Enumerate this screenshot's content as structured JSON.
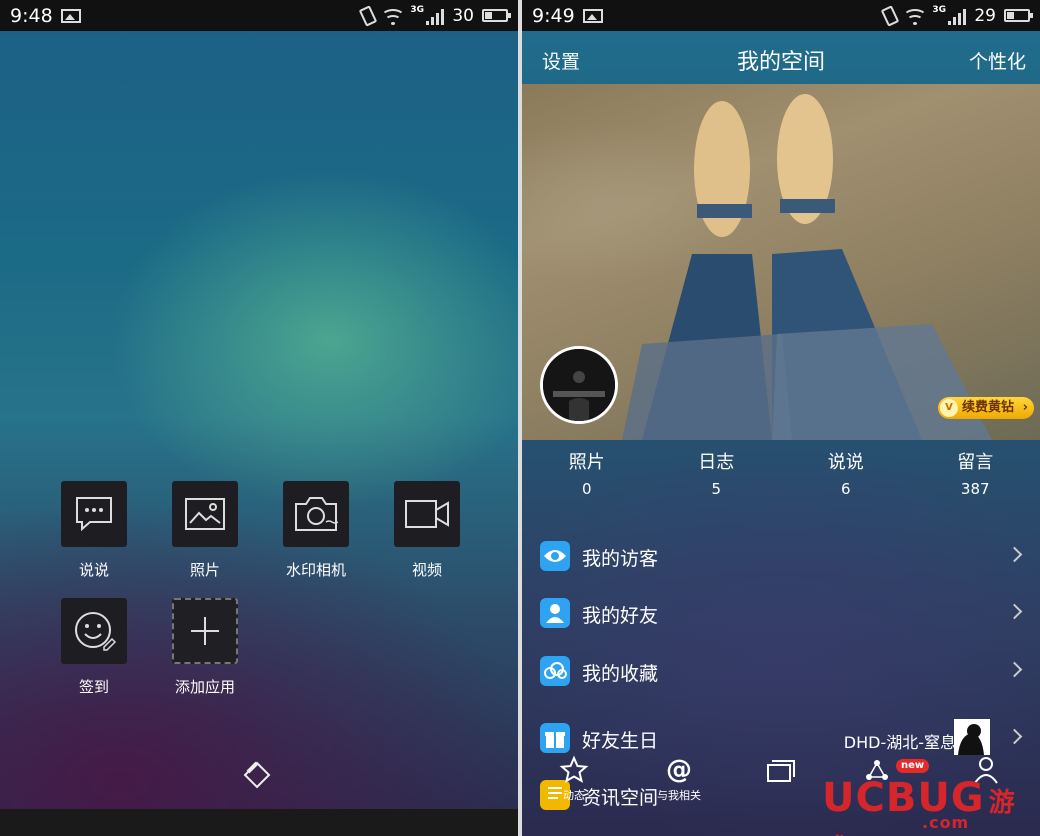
{
  "left": {
    "status": {
      "time": "9:48",
      "battery": "30",
      "network": "3G"
    },
    "tiles": [
      {
        "label": "说说",
        "icon": "chat-icon"
      },
      {
        "label": "照片",
        "icon": "photo-icon"
      },
      {
        "label": "水印相机",
        "icon": "camera-icon"
      },
      {
        "label": "视频",
        "icon": "video-icon"
      },
      {
        "label": "签到",
        "icon": "smile-icon"
      },
      {
        "label": "添加应用",
        "icon": "plus-icon"
      }
    ]
  },
  "right": {
    "status": {
      "time": "9:49",
      "battery": "29",
      "network": "3G"
    },
    "topbar": {
      "settings": "设置",
      "title": "我的空间",
      "personalize": "个性化"
    },
    "vip_badge": "续费黄钻",
    "stats": [
      {
        "label": "照片",
        "value": "0"
      },
      {
        "label": "日志",
        "value": "5"
      },
      {
        "label": "说说",
        "value": "6"
      },
      {
        "label": "留言",
        "value": "387"
      }
    ],
    "menu": [
      {
        "label": "我的访客",
        "icon": "eye-icon",
        "color": "#2ea3f2"
      },
      {
        "label": "我的好友",
        "icon": "friend-icon",
        "color": "#2ea3f2"
      },
      {
        "label": "我的收藏",
        "icon": "cloud-icon",
        "color": "#2ea3f2"
      },
      {
        "label": "好友生日",
        "icon": "gift-icon",
        "color": "#2ea3f2",
        "extra": "DHD-湖北-窒息"
      },
      {
        "label": "资讯空间",
        "icon": "news-icon",
        "color": "#f2b800"
      }
    ],
    "tabs": [
      {
        "label": "动态",
        "icon": "star-icon"
      },
      {
        "label": "与我相关",
        "icon": "at-icon"
      },
      {
        "label": "",
        "icon": "window-icon"
      },
      {
        "label": "",
        "icon": "network-icon",
        "badge": "new"
      },
      {
        "label": "",
        "icon": "person-icon"
      }
    ],
    "watermark": {
      "brand": "UCBUG",
      "suffix": "游戏网",
      "domain": ".com"
    }
  }
}
